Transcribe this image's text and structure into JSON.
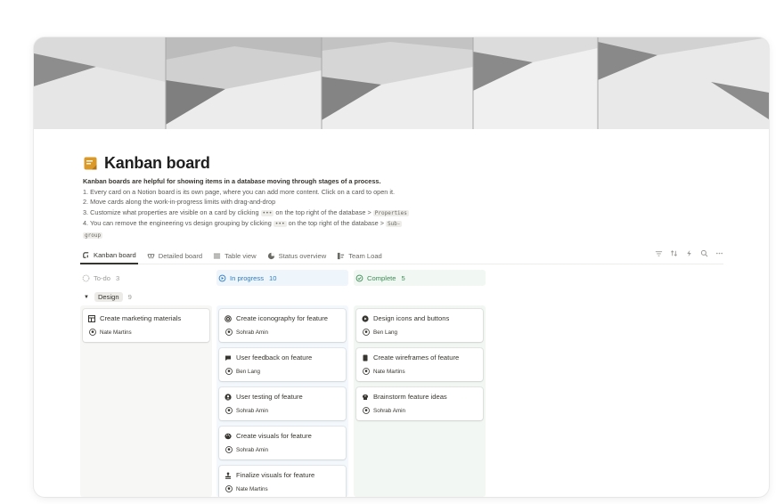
{
  "page": {
    "title": "Kanban board",
    "description": {
      "intro": "Kanban boards are helpful for showing items in a database moving through stages of a process.",
      "line1": "1. Every card on a Notion board is its own page, where you can add more content. Click on a card to open it.",
      "line2": "2. Move cards along the work-in-progress limits with drag-and-drop",
      "line3_a": "3. Customize what properties are visible on a card by clicking",
      "line3_code1": "•••",
      "line3_b": "on the top right of the database  >",
      "line3_code2": "Properties",
      "line4_a": "4. You can remove the engineering vs design grouping by clicking",
      "line4_code1": "•••",
      "line4_b": "on the top right of the database  >",
      "line4_code2": "Sub-",
      "line4_code3": "group"
    }
  },
  "tabs": [
    {
      "label": "Kanban board",
      "icon": "board-icon",
      "active": true
    },
    {
      "label": "Detailed board",
      "icon": "board-detailed-icon",
      "active": false
    },
    {
      "label": "Table view",
      "icon": "table-icon",
      "active": false
    },
    {
      "label": "Status overview",
      "icon": "pie-icon",
      "active": false
    },
    {
      "label": "Team Load",
      "icon": "team-load-icon",
      "active": false
    }
  ],
  "toolbar_icons": [
    "filter-icon",
    "sort-icon",
    "lightning-icon",
    "search-icon",
    "more-icon"
  ],
  "columns": [
    {
      "label": "To-do",
      "count": "3",
      "color": "#9b9a97"
    },
    {
      "label": "In progress",
      "count": "10",
      "color": "#2e7cc4"
    },
    {
      "label": "Complete",
      "count": "5",
      "color": "#3f8e58"
    }
  ],
  "group": {
    "label": "Design",
    "count": "9"
  },
  "cards": {
    "todo": [
      {
        "title": "Create marketing materials",
        "person": "Nate Martins",
        "icon": "layout-icon"
      }
    ],
    "progress": [
      {
        "title": "Create iconography for feature",
        "person": "Sohrab Amin",
        "icon": "target-icon"
      },
      {
        "title": "User feedback on feature",
        "person": "Ben Lang",
        "icon": "chat-bubble-icon"
      },
      {
        "title": "User testing of feature",
        "person": "Sohrab Amin",
        "icon": "user-circle-icon"
      },
      {
        "title": "Create visuals for feature",
        "person": "Sohrab Amin",
        "icon": "palette-icon"
      },
      {
        "title": "Finalize visuals for feature",
        "person": "Nate Martins",
        "icon": "stamp-icon"
      }
    ],
    "done": [
      {
        "title": "Design icons and buttons",
        "person": "Ben Lang",
        "icon": "play-circle-icon"
      },
      {
        "title": "Create wireframes of feature",
        "person": "Nate Martins",
        "icon": "document-icon"
      },
      {
        "title": "Brainstorm feature ideas",
        "person": "Sohrab Amin",
        "icon": "brain-icon"
      }
    ]
  }
}
